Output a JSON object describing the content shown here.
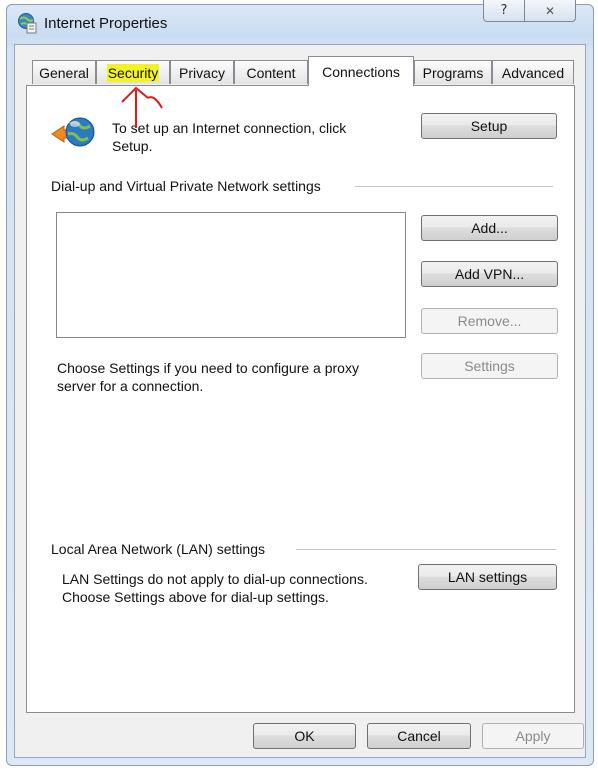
{
  "window": {
    "title": "Internet Properties",
    "help_glyph": "?",
    "close_glyph": "✕"
  },
  "tabs": [
    {
      "label": "General"
    },
    {
      "label": "Security"
    },
    {
      "label": "Privacy"
    },
    {
      "label": "Content"
    },
    {
      "label": "Connections"
    },
    {
      "label": "Programs"
    },
    {
      "label": "Advanced"
    }
  ],
  "active_tab": "Connections",
  "highlighted_tab": "Security",
  "setup": {
    "description_line1": "To set up an Internet connection, click",
    "description_line2": "Setup.",
    "button": "Setup"
  },
  "dialup": {
    "group_label": "Dial-up and Virtual Private Network settings",
    "add_button": "Add...",
    "add_vpn_button": "Add VPN...",
    "remove_button": "Remove...",
    "settings_button": "Settings",
    "proxy_line1": "Choose Settings if you need to configure a proxy",
    "proxy_line2": "server for a connection."
  },
  "lan": {
    "group_label": "Local Area Network (LAN) settings",
    "note_line1": "LAN Settings do not apply to dial-up connections.",
    "note_line2": "Choose Settings above for dial-up settings.",
    "button": "LAN settings"
  },
  "footer": {
    "ok": "OK",
    "cancel": "Cancel",
    "apply": "Apply"
  },
  "colors": {
    "highlight": "#f3f227",
    "annotation_arrow": "#e01818"
  },
  "icons": {
    "title_icon": "internet-options-icon",
    "setup_icon": "globe-network-icon"
  }
}
